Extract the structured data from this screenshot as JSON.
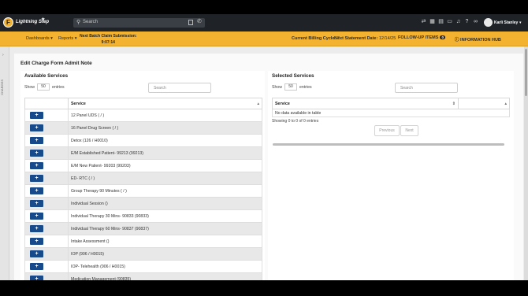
{
  "topbar": {
    "logo_letter": "F",
    "brand": "Lightning Step",
    "search_placeholder": "Search",
    "user_name": "Karli Stanley"
  },
  "nav": {
    "dashboards": "Dashboards ▾",
    "reports": "Reports ▾",
    "batch_label": "Next Batch Claim Submission:",
    "batch_time": "9:07:14",
    "billing_label": "Current Billing Cycle:",
    "billing_value": "7",
    "statement_label": "Next Statement Date:",
    "statement_value": "12/14/25",
    "followup_label": "FOLLOW-UP ITEMS",
    "followup_count": "0",
    "info_hub": "INFORMATION HUB"
  },
  "sidebar": {
    "label": "CHARGES"
  },
  "page": {
    "title": "Edit Charge Form Admit Note"
  },
  "available": {
    "title": "Available Services",
    "show_label": "Show",
    "entries_value": "50",
    "entries_label": "entries",
    "search_placeholder": "Search",
    "column": "Service",
    "add_label": "+",
    "rows": [
      "12 Panel UDS ( / )",
      "16 Panel Drug Screen ( / )",
      "Detox (126 / H0010)",
      "E/M Established Patient- 99213 (99213)",
      "E/M New Patient- 99203 (99203)",
      "ED- RTC ( / )",
      "Group Therapy 90 Minutes ( / )",
      "Individual Session ()",
      "Individual Therapy 30 Mins- 90833 (90833)",
      "Individual Therapy 60 Mins- 90837 (90837)",
      "Intake Assessment ()",
      "IOP (906 / H0015)",
      "IOP- Telehealth (906 / H0015)",
      "Medication Management (90835)"
    ]
  },
  "selected": {
    "title": "Selected Services",
    "show_label": "Show",
    "entries_value": "50",
    "entries_label": "entries",
    "search_placeholder": "Search",
    "column": "Service",
    "empty": "No data available in table",
    "info": "Showing 0 to 0 of 0 entries",
    "prev": "Previous",
    "next": "Next"
  }
}
